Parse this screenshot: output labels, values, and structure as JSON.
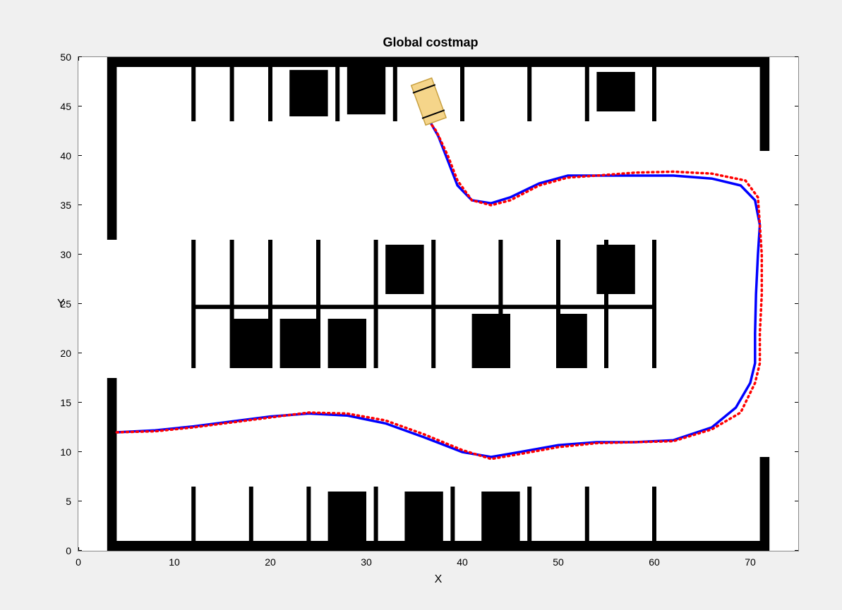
{
  "chart_data": {
    "type": "line",
    "title": "Global costmap",
    "xlabel": "X",
    "ylabel": "Y",
    "xlim": [
      0,
      75
    ],
    "ylim": [
      0,
      50
    ],
    "xticks": [
      0,
      10,
      20,
      30,
      40,
      50,
      60,
      70
    ],
    "yticks": [
      0,
      5,
      10,
      15,
      20,
      25,
      30,
      35,
      40,
      45,
      50
    ],
    "series": [
      {
        "name": "planned_path_blue",
        "color": "#0000ff",
        "style": "solid",
        "points": [
          [
            4,
            12
          ],
          [
            8,
            12.2
          ],
          [
            12,
            12.6
          ],
          [
            16,
            13.1
          ],
          [
            20,
            13.6
          ],
          [
            24,
            13.9
          ],
          [
            28,
            13.7
          ],
          [
            32,
            12.9
          ],
          [
            36,
            11.5
          ],
          [
            40,
            10
          ],
          [
            43,
            9.5
          ],
          [
            46,
            10
          ],
          [
            50,
            10.7
          ],
          [
            54,
            11
          ],
          [
            58,
            11
          ],
          [
            62,
            11.2
          ],
          [
            66,
            12.5
          ],
          [
            68.5,
            14.5
          ],
          [
            70,
            17
          ],
          [
            70.5,
            19
          ],
          [
            70.5,
            22
          ],
          [
            70.6,
            26
          ],
          [
            70.8,
            30
          ],
          [
            71,
            33
          ],
          [
            70.5,
            35.5
          ],
          [
            69,
            37
          ],
          [
            66,
            37.7
          ],
          [
            62,
            38
          ],
          [
            58,
            38
          ],
          [
            54,
            38
          ],
          [
            51,
            38
          ],
          [
            48,
            37.2
          ],
          [
            45,
            35.8
          ],
          [
            43,
            35.2
          ],
          [
            41,
            35.5
          ],
          [
            39.5,
            37
          ],
          [
            38.5,
            39.5
          ],
          [
            37.5,
            42
          ],
          [
            36.5,
            43.7
          ]
        ]
      },
      {
        "name": "actual_path_red",
        "color": "#ff0000",
        "style": "dotted",
        "points": [
          [
            4,
            12
          ],
          [
            8,
            12.1
          ],
          [
            12,
            12.5
          ],
          [
            16,
            13.0
          ],
          [
            20,
            13.5
          ],
          [
            24,
            14.0
          ],
          [
            28,
            13.9
          ],
          [
            32,
            13.2
          ],
          [
            36,
            11.8
          ],
          [
            40,
            10.2
          ],
          [
            43,
            9.3
          ],
          [
            46,
            9.8
          ],
          [
            50,
            10.5
          ],
          [
            54,
            10.9
          ],
          [
            58,
            11
          ],
          [
            62,
            11.1
          ],
          [
            66,
            12.3
          ],
          [
            69,
            14
          ],
          [
            70.5,
            17
          ],
          [
            71,
            19
          ],
          [
            71,
            22
          ],
          [
            71.2,
            26
          ],
          [
            71.2,
            30
          ],
          [
            71,
            33
          ],
          [
            70.8,
            35.8
          ],
          [
            69.5,
            37.5
          ],
          [
            66,
            38.2
          ],
          [
            62,
            38.4
          ],
          [
            58,
            38.3
          ],
          [
            54,
            38
          ],
          [
            51,
            37.8
          ],
          [
            48,
            37
          ],
          [
            45,
            35.5
          ],
          [
            43,
            35
          ],
          [
            41,
            35.5
          ],
          [
            39.5,
            37.5
          ],
          [
            38.5,
            40
          ],
          [
            37.3,
            42.5
          ],
          [
            36.3,
            43.8
          ]
        ]
      }
    ],
    "vehicle": {
      "x": 36.5,
      "y": 45.5,
      "angle_deg": -70,
      "length": 4.4,
      "width": 2.2
    },
    "obstacles": {
      "boundary_walls": [
        {
          "x1": 3,
          "y1": 49,
          "x2": 72,
          "y2": 50
        },
        {
          "x1": 3,
          "y1": 0,
          "x2": 72,
          "y2": 1
        },
        {
          "x1": 3,
          "y1": 1,
          "x2": 4,
          "y2": 17.5
        },
        {
          "x1": 3,
          "y1": 31.5,
          "x2": 4,
          "y2": 49
        },
        {
          "x1": 71,
          "y1": 1,
          "x2": 72,
          "y2": 9.5
        },
        {
          "x1": 71,
          "y1": 40.5,
          "x2": 72,
          "y2": 49
        }
      ],
      "parked_cars": [
        {
          "x1": 22,
          "y1": 44,
          "x2": 26,
          "y2": 48.7
        },
        {
          "x1": 28,
          "y1": 44.2,
          "x2": 32,
          "y2": 49
        },
        {
          "x1": 54,
          "y1": 44.5,
          "x2": 58,
          "y2": 48.5
        },
        {
          "x1": 32,
          "y1": 26,
          "x2": 36,
          "y2": 31
        },
        {
          "x1": 54,
          "y1": 26,
          "x2": 58,
          "y2": 31
        },
        {
          "x1": 16,
          "y1": 18.5,
          "x2": 20,
          "y2": 23.5
        },
        {
          "x1": 21,
          "y1": 18.5,
          "x2": 25,
          "y2": 23.5
        },
        {
          "x1": 26,
          "y1": 18.5,
          "x2": 30,
          "y2": 23.5
        },
        {
          "x1": 41,
          "y1": 18.5,
          "x2": 45,
          "y2": 24
        },
        {
          "x1": 50,
          "y1": 18.5,
          "x2": 53,
          "y2": 24
        },
        {
          "x1": 26,
          "y1": 1,
          "x2": 30,
          "y2": 6
        },
        {
          "x1": 34,
          "y1": 1,
          "x2": 38,
          "y2": 6
        },
        {
          "x1": 42,
          "y1": 1,
          "x2": 46,
          "y2": 6
        }
      ],
      "dividers_top": {
        "y1": 43.5,
        "y2": 49,
        "xs": [
          12,
          16,
          20,
          27,
          33,
          40,
          47,
          53,
          60
        ]
      },
      "dividers_mid": {
        "y1_up": 25,
        "y2_up": 31.5,
        "y1_dn": 18.5,
        "y2_dn": 25,
        "hline_y": 24.7,
        "hx1": 12,
        "hx2": 60,
        "xs": [
          12,
          16,
          20,
          25,
          31,
          37,
          44,
          50,
          55,
          60
        ]
      },
      "dividers_bot": {
        "y1": 1,
        "y2": 6.5,
        "xs": [
          12,
          18,
          24,
          31,
          39,
          47,
          53,
          60
        ]
      }
    }
  }
}
